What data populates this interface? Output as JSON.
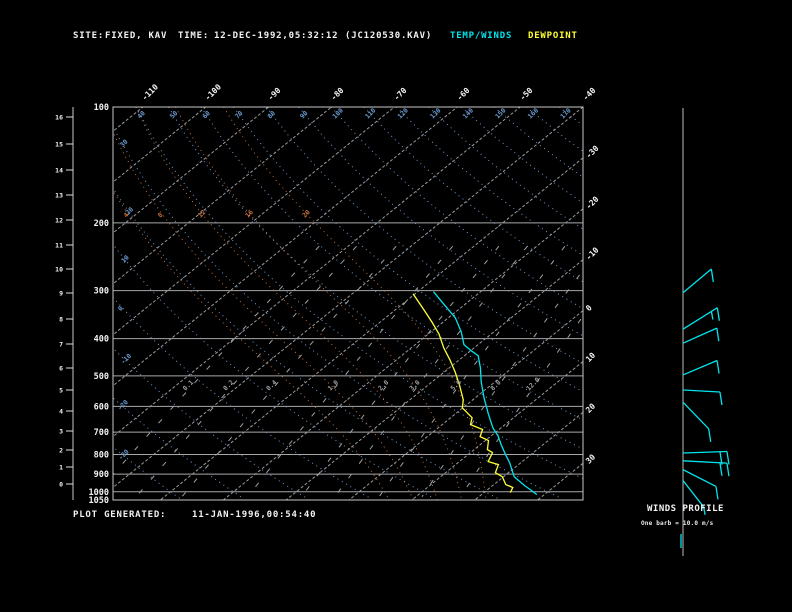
{
  "header": {
    "site_label": "SITE:",
    "site_value": "FIXED, KAV",
    "time_label": "TIME:",
    "time_value": "12-DEC-1992,05:32:12",
    "file_id": "(JC120530.KAV)",
    "legend_temp": "TEMP/WINDS",
    "legend_dew": "DEWPOINT"
  },
  "footer": {
    "label": "PLOT GENERATED:",
    "value": "11-JAN-1996,00:54:40"
  },
  "winds_panel": {
    "title": "WINDS PROFILE",
    "subtitle": "One barb = 10.0 m/s"
  },
  "colors": {
    "background": "#000000",
    "grid": "#a8a8a8",
    "border": "#c8c8c8",
    "isotherm": "#9a9a9a",
    "dry_adiabat": "#6b9bd2",
    "moist_adiabat": "#c8703c",
    "mixing_ratio": "#a0a0a0",
    "temperature": "#00e5ee",
    "dewpoint": "#ffff33",
    "axis_text": "#f2f2f2"
  },
  "chart_data": {
    "type": "skewt_log_p",
    "pressure_ticks_hpa": [
      100,
      200,
      300,
      400,
      500,
      600,
      700,
      800,
      900,
      1000,
      1050
    ],
    "height_ticks_km": [
      0,
      1,
      2,
      3,
      4,
      5,
      6,
      7,
      8,
      9,
      10,
      11,
      12,
      13,
      14,
      15,
      16
    ],
    "top_temp_labels_c": [
      -110,
      -100,
      -90,
      -80,
      -70,
      -60,
      -50,
      -40
    ],
    "right_temp_labels_c": [
      -30,
      -20,
      -10,
      0,
      10,
      20,
      30
    ],
    "isotherms_c": [
      -110,
      -100,
      -90,
      -80,
      -70,
      -60,
      -50,
      -40,
      -30,
      -20,
      -10,
      0,
      10,
      20,
      30
    ],
    "dry_adiabats_c": [
      -50,
      -40,
      -30,
      -20,
      -10,
      0,
      10,
      20,
      30,
      40,
      50,
      60,
      70,
      80,
      90,
      100,
      110,
      120,
      130,
      140,
      150,
      160,
      170
    ],
    "moist_adiabats_c": [
      4,
      8,
      12,
      16,
      20
    ],
    "mixing_ratio_g_per_kg": [
      0.1,
      0.2,
      0.4,
      1.0,
      2.0,
      3.0,
      5.0,
      8.0,
      12.0
    ],
    "series": [
      {
        "name": "TEMP",
        "color": "#00e5ee",
        "points_p_t": [
          [
            1017,
            28.8
          ],
          [
            993,
            27.2
          ],
          [
            964,
            25.1
          ],
          [
            914,
            21.7
          ],
          [
            840,
            18.2
          ],
          [
            801,
            16.0
          ],
          [
            759,
            13.6
          ],
          [
            716,
            11.1
          ],
          [
            682,
            8.7
          ],
          [
            627,
            5.2
          ],
          [
            570,
            1.4
          ],
          [
            518,
            -2.2
          ],
          [
            476,
            -5.1
          ],
          [
            443,
            -7.8
          ],
          [
            430,
            -9.9
          ],
          [
            415,
            -12.2
          ],
          [
            384,
            -15.2
          ],
          [
            353,
            -18.9
          ],
          [
            323,
            -23.8
          ],
          [
            302,
            -27.5
          ]
        ]
      },
      {
        "name": "DEWPOINT",
        "color": "#ffff33",
        "points_p_t": [
          [
            1005,
            24.2
          ],
          [
            975,
            23.6
          ],
          [
            958,
            21.9
          ],
          [
            914,
            19.8
          ],
          [
            892,
            17.9
          ],
          [
            850,
            16.8
          ],
          [
            835,
            14.6
          ],
          [
            791,
            13.5
          ],
          [
            777,
            12.1
          ],
          [
            736,
            10.5
          ],
          [
            719,
            8.4
          ],
          [
            689,
            7.4
          ],
          [
            669,
            4.5
          ],
          [
            642,
            3.4
          ],
          [
            605,
            -0.1
          ],
          [
            577,
            -1.5
          ],
          [
            527,
            -5.1
          ],
          [
            488,
            -8.3
          ],
          [
            454,
            -11.5
          ],
          [
            423,
            -14.8
          ],
          [
            389,
            -18.3
          ],
          [
            362,
            -21.8
          ],
          [
            333,
            -26.0
          ],
          [
            306,
            -30.3
          ]
        ]
      }
    ],
    "winds_profile": {
      "barb_unit_ms": 10,
      "barbs": [
        {
          "p": 304,
          "speed_ms": 10,
          "shaft_angle_deg": -40
        },
        {
          "p": 378,
          "speed_ms": 15,
          "shaft_angle_deg": -32
        },
        {
          "p": 411,
          "speed_ms": 10,
          "shaft_angle_deg": -24
        },
        {
          "p": 497,
          "speed_ms": 10,
          "shaft_angle_deg": -23
        },
        {
          "p": 544,
          "speed_ms": 10,
          "shaft_angle_deg": 3
        },
        {
          "p": 585,
          "speed_ms": 10,
          "shaft_angle_deg": 46
        },
        {
          "p": 793,
          "speed_ms": 20,
          "shaft_angle_deg": -2
        },
        {
          "p": 831,
          "speed_ms": 20,
          "shaft_angle_deg": 3
        },
        {
          "p": 876,
          "speed_ms": 10,
          "shaft_angle_deg": 27
        },
        {
          "p": 935,
          "speed_ms": 5,
          "shaft_angle_deg": 52
        }
      ]
    }
  }
}
